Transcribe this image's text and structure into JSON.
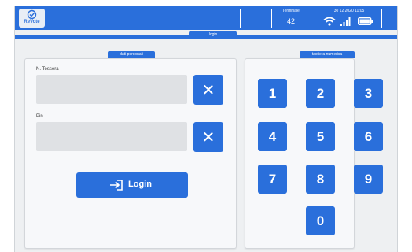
{
  "header": {
    "logo_text": "ReVote",
    "terminal_label": "Terminale",
    "terminal_number": "42",
    "datetime": "30 12 2020 11:05"
  },
  "tab": {
    "label": "login"
  },
  "personal_data": {
    "section_label": "dati personali",
    "card_label": "N. Tessera",
    "card_value": "",
    "pin_label": "Pin",
    "pin_value": "",
    "clear_glyph": "✕",
    "login_label": "Login"
  },
  "keypad": {
    "section_label": "tastiera numerica",
    "keys": [
      "1",
      "2",
      "3",
      "4",
      "5",
      "6",
      "7",
      "8",
      "9",
      "0"
    ]
  },
  "colors": {
    "accent": "#2a6fdb",
    "background": "#eef0f2",
    "field": "#dfe1e4"
  }
}
